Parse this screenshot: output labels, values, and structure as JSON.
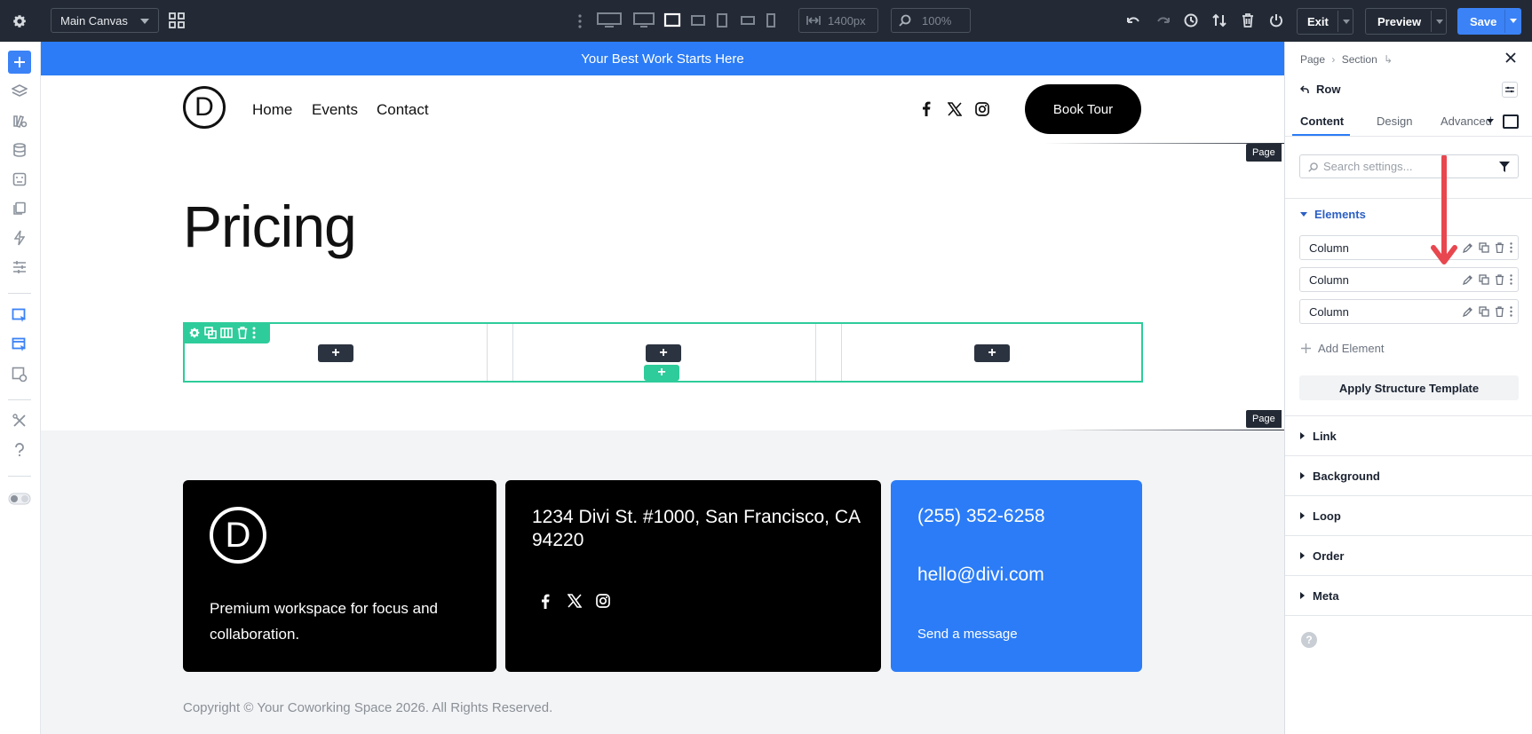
{
  "topbar": {
    "canvas_select": "Main Canvas",
    "width_value": "1400px",
    "zoom_value": "100%",
    "exit_label": "Exit",
    "preview_label": "Preview",
    "save_label": "Save"
  },
  "page": {
    "banner": "Your Best Work Starts Here",
    "logo_letter": "D",
    "nav": [
      "Home",
      "Events",
      "Contact"
    ],
    "book_tour": "Book Tour",
    "page_tag": "Page",
    "heading": "Pricing",
    "add_symbol": "+"
  },
  "footer": {
    "card1_text": "Premium workspace for focus and collaboration.",
    "address": "1234 Divi St. #1000, San Francisco, CA 94220",
    "phone": "(255) 352-6258",
    "email": "hello@divi.com",
    "send": "Send a message",
    "copyright": "Copyright © Your Coworking Space 2026. All Rights Reserved."
  },
  "panel": {
    "breadcrumb_1": "Page",
    "breadcrumb_2": "Section",
    "title": "Row",
    "tabs": [
      "Content",
      "Design",
      "Advanced"
    ],
    "search_placeholder": "Search settings...",
    "elements_label": "Elements",
    "elements": [
      "Column",
      "Column",
      "Column"
    ],
    "add_element": "Add Element",
    "apply_template": "Apply Structure Template",
    "groups": [
      "Link",
      "Background",
      "Loop",
      "Order",
      "Meta"
    ]
  },
  "colors": {
    "accent": "#2b7cf6",
    "row_outline": "#2ecc9a",
    "annotation_arrow": "#e8474f",
    "topbar": "#232a35"
  }
}
